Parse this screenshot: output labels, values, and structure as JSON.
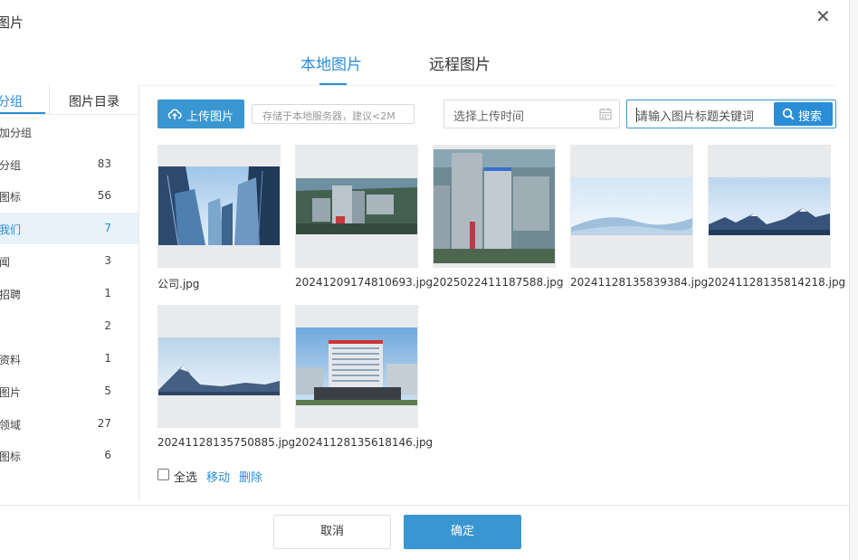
{
  "dialog": {
    "title": "图片"
  },
  "tabs": [
    {
      "label": "本地图片",
      "active": true
    },
    {
      "label": "远程图片",
      "active": false
    }
  ],
  "sidebar": {
    "tabs": [
      {
        "label": "分组",
        "active": true
      },
      {
        "label": "图片目录",
        "active": false
      }
    ],
    "add_group": "加分组",
    "groups": [
      {
        "name": "分组",
        "count": "83",
        "active": false
      },
      {
        "name": "图标",
        "count": "56",
        "active": false
      },
      {
        "name": "我们",
        "count": "7",
        "active": true
      },
      {
        "name": "闻",
        "count": "3",
        "active": false
      },
      {
        "name": "招聘",
        "count": "1",
        "active": false
      },
      {
        "name": "",
        "count": "2",
        "active": false
      },
      {
        "name": "资料",
        "count": "1",
        "active": false
      },
      {
        "name": "图片",
        "count": "5",
        "active": false
      },
      {
        "name": "领域",
        "count": "27",
        "active": false
      },
      {
        "name": "图标",
        "count": "6",
        "active": false
      }
    ]
  },
  "toolbar": {
    "upload_label": "上传图片",
    "upload_tip": "存储于本地服务器，建议<2M",
    "date_placeholder": "选择上传时间",
    "search_placeholder": "请输入图片标题关键词",
    "search_label": "搜索"
  },
  "images": [
    {
      "name": "公司.jpg",
      "scene": "skyscrapers"
    },
    {
      "name": "20241209174810693.jpg",
      "scene": "campus"
    },
    {
      "name": "2025022411187588.jpg",
      "scene": "campus-tall"
    },
    {
      "name": "20241128135839384.jpg",
      "scene": "hills"
    },
    {
      "name": "20241128135814218.jpg",
      "scene": "snow-mountains"
    },
    {
      "name": "20241128135750885.jpg",
      "scene": "matterhorn"
    },
    {
      "name": "20241128135618146.jpg",
      "scene": "hospital"
    }
  ],
  "actions": {
    "select_all": "全选",
    "move": "移动",
    "delete": "删除"
  },
  "footer": {
    "cancel": "取消",
    "confirm": "确定"
  },
  "colors": {
    "accent": "#2a8ed6",
    "button": "#3a96d0",
    "active_row_bg": "#e8f2fb",
    "thumb_bg": "#e9eaec"
  }
}
